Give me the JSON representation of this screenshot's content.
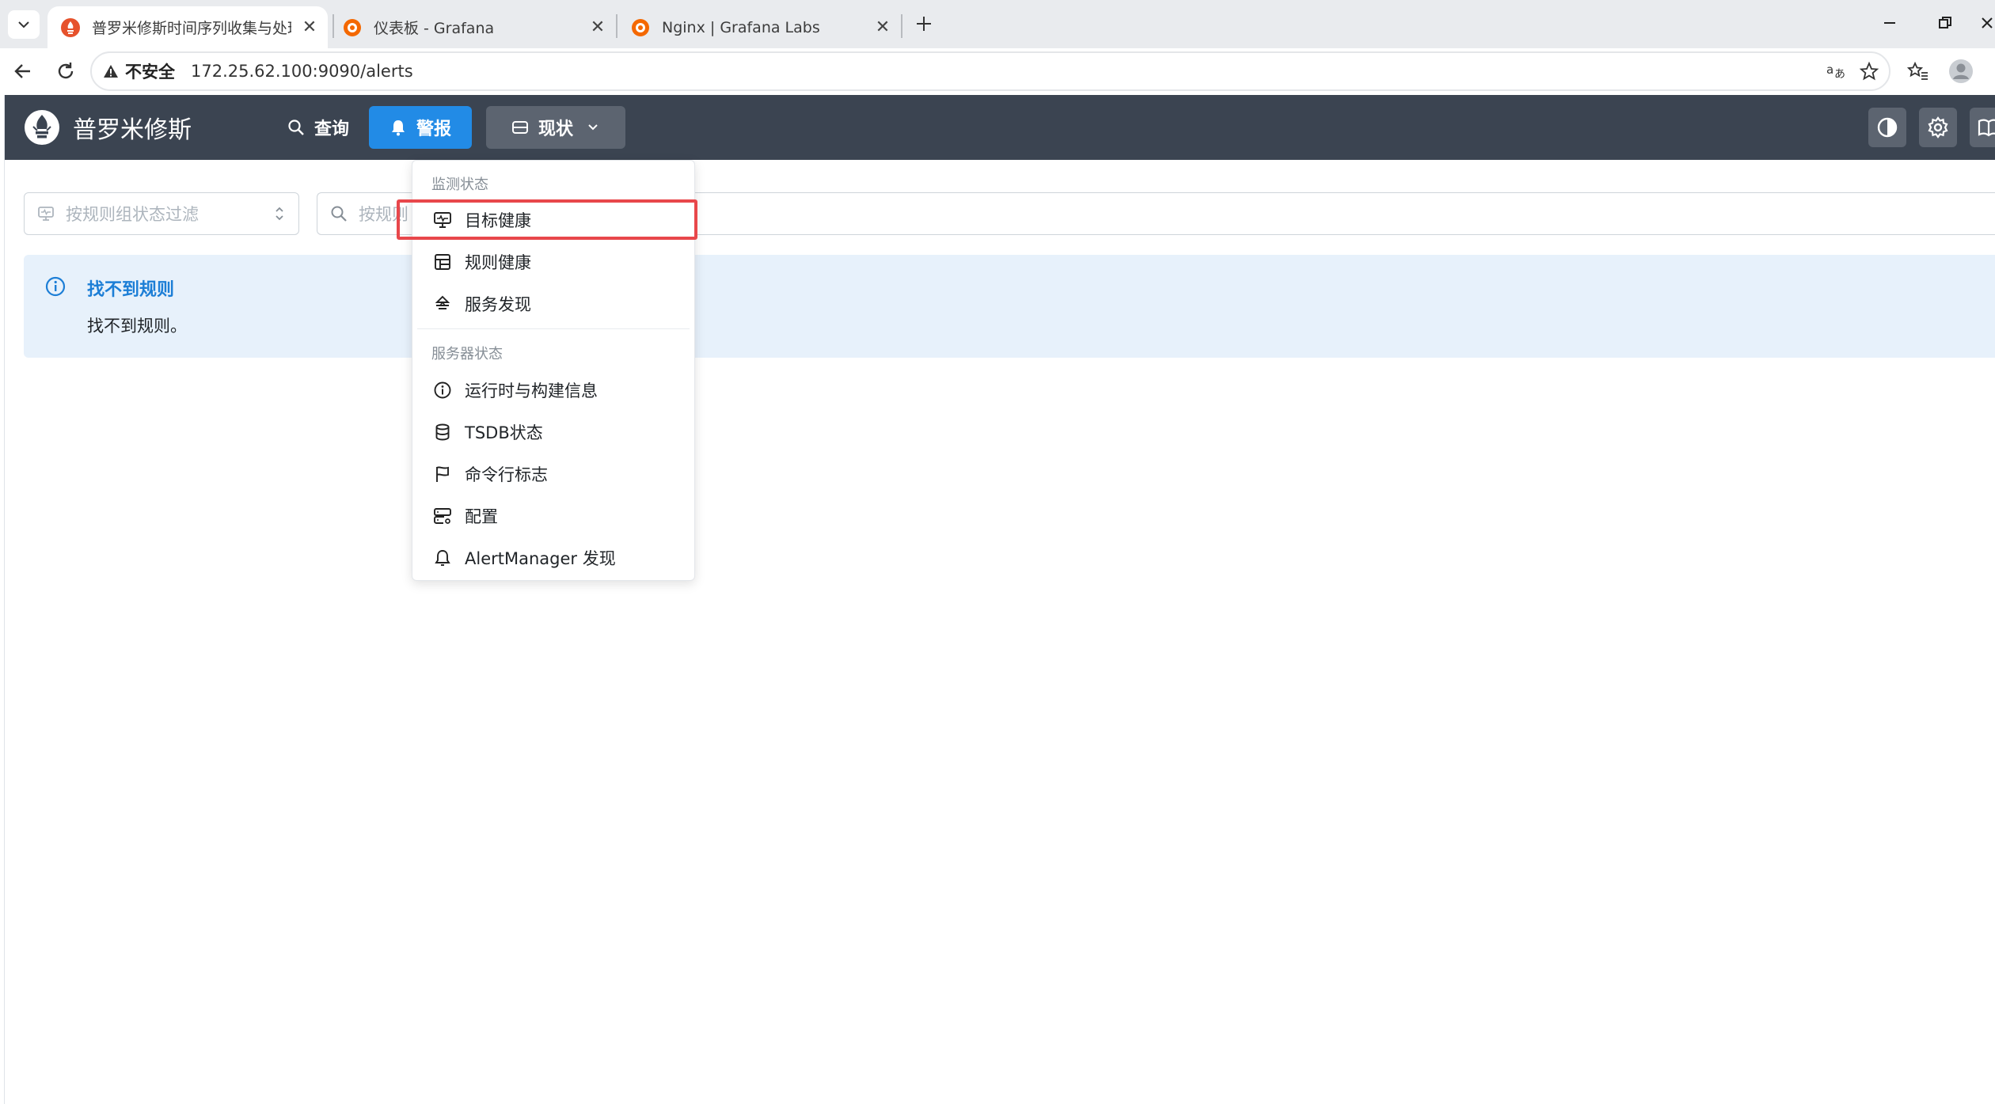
{
  "browser": {
    "tabs": [
      {
        "title": "普罗米修斯时间序列收集与处理服",
        "icon": "prometheus-icon",
        "active": true
      },
      {
        "title": "仪表板 - Grafana",
        "icon": "grafana-icon",
        "active": false
      },
      {
        "title": "Nginx | Grafana Labs",
        "icon": "grafana-icon",
        "active": false
      }
    ],
    "security_label": "不安全",
    "url": "172.25.62.100:9090/alerts"
  },
  "app": {
    "brand": "普罗米修斯",
    "nav": {
      "query": "查询",
      "alerts": "警报",
      "status": "现状"
    },
    "accent_color": "#228be6",
    "navbar_color": "#3b4451"
  },
  "filters": {
    "state_placeholder": "按规则组状态过滤",
    "search_placeholder": "按规则"
  },
  "alert": {
    "title": "找不到规则",
    "message": "找不到规则。"
  },
  "status_menu": {
    "monitoring_section": "监测状态",
    "monitoring_items": [
      {
        "label": "目标健康",
        "icon": "monitor-icon"
      },
      {
        "label": "规则健康",
        "icon": "table-icon"
      },
      {
        "label": "服务发现",
        "icon": "service-discovery-icon"
      }
    ],
    "server_section": "服务器状态",
    "server_items": [
      {
        "label": "运行时与构建信息",
        "icon": "info-icon"
      },
      {
        "label": "TSDB状态",
        "icon": "database-icon"
      },
      {
        "label": "命令行标志",
        "icon": "flag-icon"
      },
      {
        "label": "配置",
        "icon": "server-cog-icon"
      },
      {
        "label": "AlertManager 发现",
        "icon": "bell-icon"
      }
    ],
    "highlight_color": "#e8474b"
  }
}
